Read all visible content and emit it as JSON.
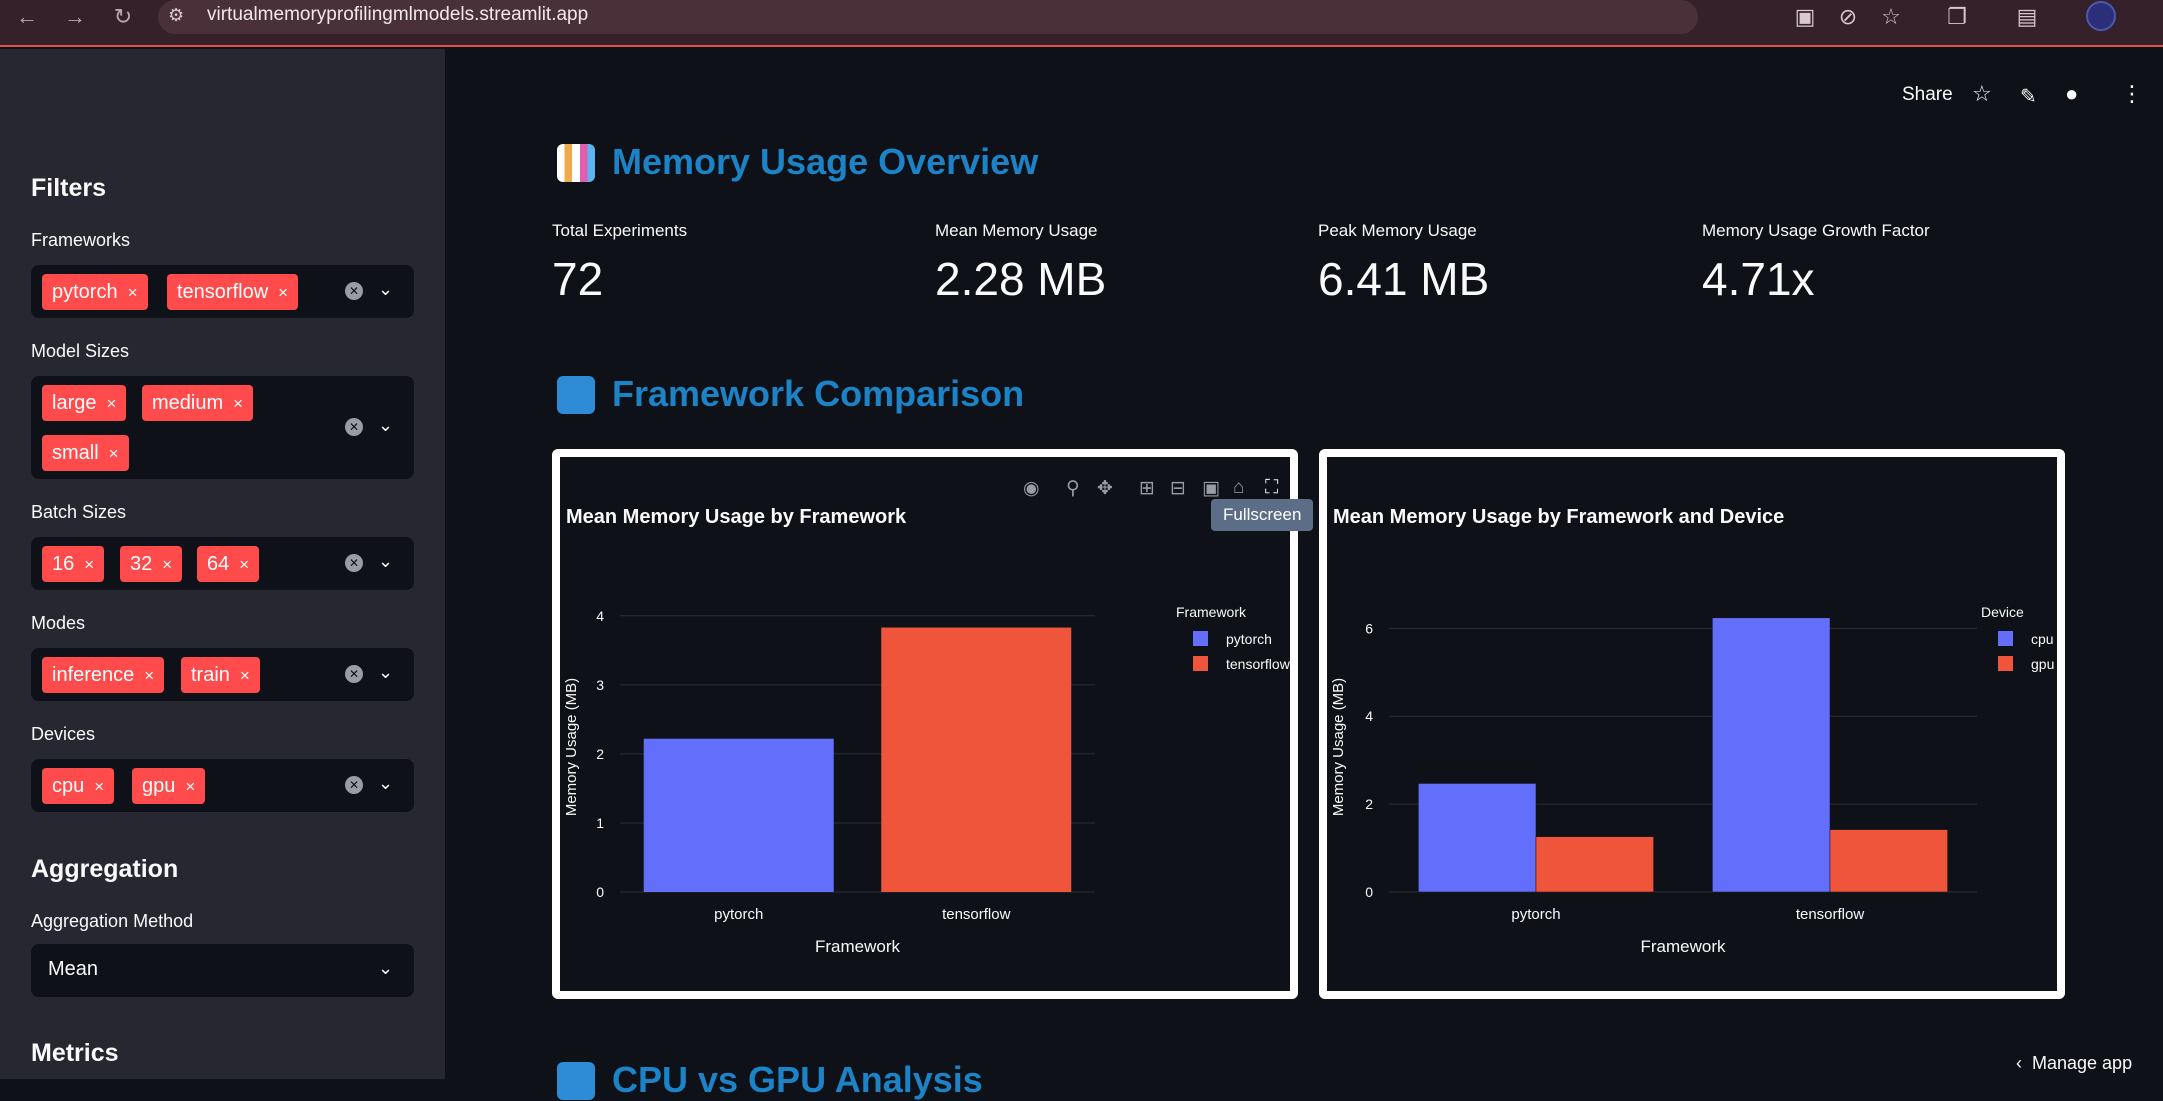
{
  "browser": {
    "url": "virtualmemoryprofilingmlmodels.streamlit.app"
  },
  "sidebar": {
    "filters_heading": "Filters",
    "frameworks": {
      "label": "Frameworks",
      "tags": [
        "pytorch",
        "tensorflow"
      ]
    },
    "model_sizes": {
      "label": "Model Sizes",
      "tags": [
        "large",
        "medium",
        "small"
      ]
    },
    "batch_sizes": {
      "label": "Batch Sizes",
      "tags": [
        "16",
        "32",
        "64"
      ]
    },
    "modes": {
      "label": "Modes",
      "tags": [
        "inference",
        "train"
      ]
    },
    "devices": {
      "label": "Devices",
      "tags": [
        "cpu",
        "gpu"
      ]
    },
    "aggregation_heading": "Aggregation",
    "aggregation_method": {
      "label": "Aggregation Method",
      "value": "Mean"
    },
    "metrics_heading": "Metrics",
    "tag_remove": "×"
  },
  "header": {
    "share_label": "Share",
    "manage_app": "Manage app"
  },
  "overview": {
    "title": "Memory Usage Overview",
    "metrics": [
      {
        "label": "Total Experiments",
        "value": "72"
      },
      {
        "label": "Mean Memory Usage",
        "value": "2.28 MB"
      },
      {
        "label": "Peak Memory Usage",
        "value": "6.41 MB"
      },
      {
        "label": "Memory Usage Growth Factor",
        "value": "4.71x"
      }
    ]
  },
  "comparison": {
    "title": "Framework Comparison",
    "tooltip": "Fullscreen",
    "next_section_title": "CPU vs GPU Analysis"
  },
  "colors": {
    "blue": "#636efa",
    "red": "#ef553b",
    "accent": "#ff4b4b",
    "title": "#1c83c7"
  },
  "chart_data": [
    {
      "type": "bar",
      "title": "Mean Memory Usage by Framework",
      "xlabel": "Framework",
      "ylabel": "Memory Usage (MB)",
      "categories": [
        "pytorch",
        "tensorflow"
      ],
      "series": [
        {
          "name": "pytorch",
          "values": [
            2.22,
            null
          ]
        },
        {
          "name": "tensorflow",
          "values": [
            null,
            3.83
          ]
        }
      ],
      "legend_title": "Framework",
      "legend_placement": "top-right",
      "ylim": [
        0,
        4.2
      ],
      "yticks": [
        0,
        1,
        2,
        3,
        4
      ],
      "grid": true
    },
    {
      "type": "bar",
      "title": "Mean Memory Usage by Framework and Device",
      "xlabel": "Framework",
      "ylabel": "Memory Usage (MB)",
      "categories": [
        "pytorch",
        "tensorflow"
      ],
      "series": [
        {
          "name": "cpu",
          "values": [
            2.47,
            6.24
          ]
        },
        {
          "name": "gpu",
          "values": [
            1.26,
            1.42
          ]
        }
      ],
      "legend_title": "Device",
      "legend_placement": "top-right",
      "ylim": [
        0,
        6.6
      ],
      "yticks": [
        0,
        2,
        4,
        6
      ],
      "grid": true
    }
  ]
}
